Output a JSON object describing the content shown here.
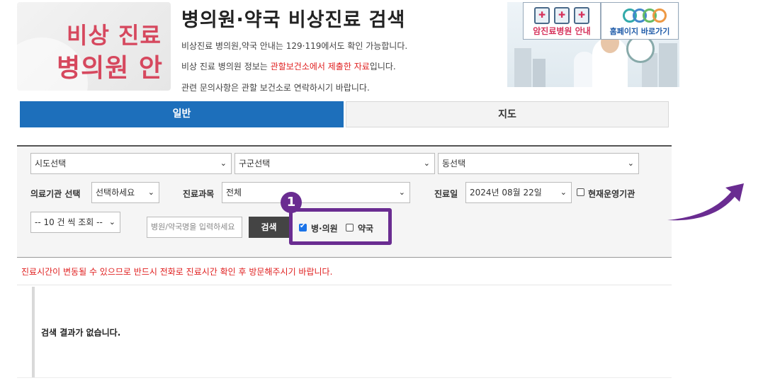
{
  "logo": {
    "line1": "비상 진료",
    "line2": "병의원 안내"
  },
  "header": {
    "title": "병의원·약국 비상진료 검색",
    "info1": "비상진료 병의원,약국 안내는 129·119에서도 확인 가능합니다.",
    "info2_prefix": "비상 진료 병의원 정보는 ",
    "info2_highlight": "관할보건소에서 제출한 자료",
    "info2_suffix": "입니다.",
    "info3": "관련 문의사항은 관할 보건소로 연락하시기 바랍니다."
  },
  "banner": {
    "left_label": "암진료병원 안내",
    "right_label": "홈페이지 바로가기"
  },
  "tabs": {
    "general": "일반",
    "map": "지도"
  },
  "search": {
    "sido": "시도선택",
    "gungu": "구군선택",
    "dong": "동선택",
    "institution_label": "의료기관 선택",
    "institution_value": "선택하세요",
    "department_label": "진료과목",
    "department_value": "전체",
    "date_label": "진료일",
    "date_value": "2024년 08월 22일",
    "operating_label": "현재운영기관",
    "page_size": "-- 10 건 씩 조회 --",
    "name_placeholder": "병원/약국명을 입력하세요",
    "search_button": "검색",
    "hospital_label": "병·의원",
    "hospital_checked": true,
    "pharmacy_label": "약국",
    "pharmacy_checked": false
  },
  "annotation": {
    "badge": "1",
    "color": "#6a2c91"
  },
  "notice": "진료시간이 변동될 수 있으므로 반드시 전화로 진료시간 확인 후 방문해주시기 바랍니다.",
  "results": {
    "empty_message": "검색 결과가 없습니다."
  },
  "colors": {
    "accent": "#1d6fbb",
    "alert": "#e02020",
    "logo": "#d6485e"
  }
}
